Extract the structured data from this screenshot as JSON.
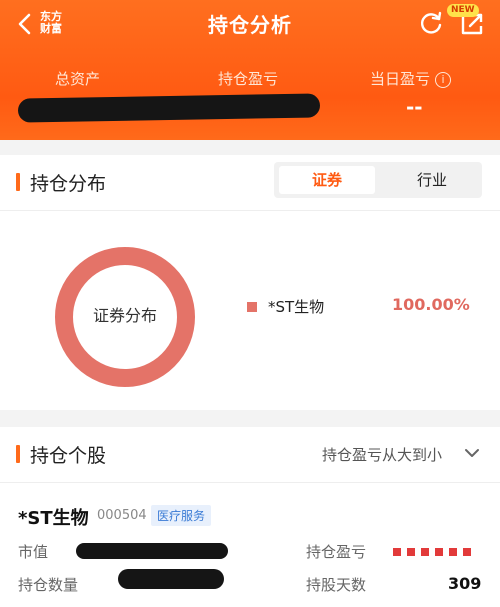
{
  "header": {
    "brand": "东方财富",
    "title": "持仓分析",
    "new_badge": "NEW",
    "metrics": {
      "total_assets_label": "总资产",
      "holding_pnl_label": "持仓盈亏",
      "today_pnl_label": "当日盈亏",
      "today_pnl_value": "--"
    }
  },
  "distribution": {
    "section_title": "持仓分布",
    "tabs": [
      "证券",
      "行业"
    ],
    "active_tab": "证券",
    "chart_label": "证券分布",
    "legend": [
      {
        "name": "*ST生物",
        "value": "100.00%",
        "color": "#e47368"
      }
    ]
  },
  "holdings": {
    "section_title": "持仓个股",
    "sort_label": "持仓盈亏从大到小",
    "stock": {
      "name": "*ST生物",
      "code": "000504",
      "tag": "医疗服务",
      "market_value_label": "市值",
      "pnl_label": "持仓盈亏",
      "qty_label": "持仓数量",
      "days_label": "持股天数",
      "days_value": "309"
    }
  },
  "colors": {
    "accent": "#ff5a12",
    "donut": "#e47368"
  }
}
